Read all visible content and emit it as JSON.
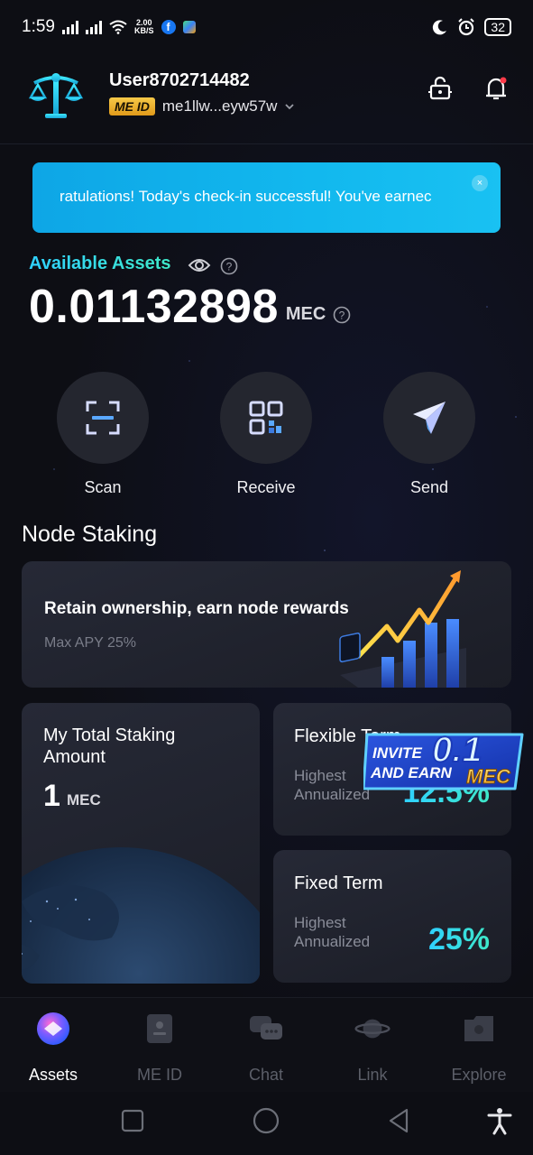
{
  "status_bar": {
    "time": "1:59",
    "net_speed_value": "2.00",
    "net_speed_unit": "KB/S",
    "battery": "32"
  },
  "header": {
    "username": "User8702714482",
    "meid_badge": "ME ID",
    "meid_address": "me1llw...eyw57w"
  },
  "banner": {
    "text": "ratulations! Today's check-in successful! You've earnec",
    "close": "×"
  },
  "assets": {
    "label": "Available Assets",
    "balance": "0.01132898",
    "unit": "MEC"
  },
  "actions": [
    {
      "label": "Scan",
      "icon": "scan-icon"
    },
    {
      "label": "Receive",
      "icon": "qr-code-icon"
    },
    {
      "label": "Send",
      "icon": "paper-plane-icon"
    }
  ],
  "node_staking": {
    "title": "Node Staking",
    "retain_title": "Retain ownership, earn node rewards",
    "retain_sub": "Max APY 25%",
    "my_staking_title": "My Total Staking Amount",
    "my_staking_value": "1",
    "my_staking_unit": "MEC",
    "flexible_title": "Flexible Term",
    "flexible_sub_1": "Highest",
    "flexible_sub_2": "Annualized",
    "flexible_rate": "12.5%",
    "fixed_title": "Fixed Term",
    "fixed_sub_1": "Highest",
    "fixed_sub_2": "Annualized",
    "fixed_rate": "25%"
  },
  "invite_badge": {
    "line1": "INVITE",
    "line2": "AND EARN",
    "amount": "0.1",
    "unit": "MEC"
  },
  "bottom_nav": [
    {
      "label": "Assets",
      "icon": "assets-icon",
      "active": true
    },
    {
      "label": "ME ID",
      "icon": "id-card-icon",
      "active": false
    },
    {
      "label": "Chat",
      "icon": "chat-icon",
      "active": false
    },
    {
      "label": "Link",
      "icon": "planet-icon",
      "active": false
    },
    {
      "label": "Explore",
      "icon": "explore-icon",
      "active": false
    }
  ],
  "colors": {
    "background": "#0d0e14",
    "accent_cyan": "#2fd1ff",
    "banner_blue": "#12b8ee",
    "badge_gold": "#f7c948",
    "card": "#22252f"
  }
}
